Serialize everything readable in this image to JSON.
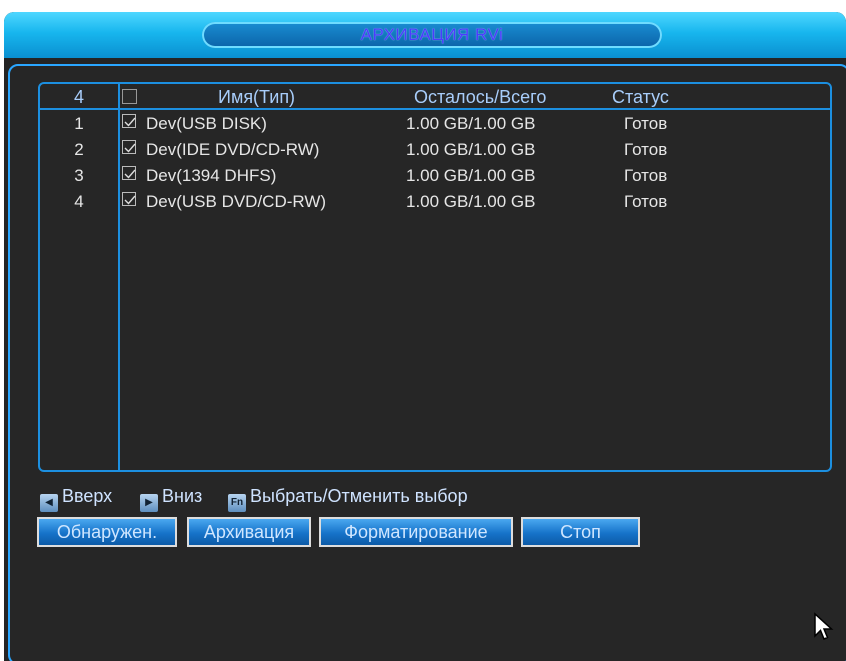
{
  "window": {
    "title": "АРХИВАЦИЯ RVi"
  },
  "table": {
    "header": {
      "count": "4",
      "name": "Имя(Тип)",
      "space": "Осталось/Всего",
      "status": "Статус"
    },
    "rows": [
      {
        "num": "1",
        "name": "Dev(USB DISK)",
        "space": "1.00 GB/1.00 GB",
        "status": "Готов",
        "checked": true
      },
      {
        "num": "2",
        "name": "Dev(IDE DVD/CD-RW)",
        "space": "1.00 GB/1.00 GB",
        "status": "Готов",
        "checked": true
      },
      {
        "num": "3",
        "name": "Dev(1394 DHFS)",
        "space": "1.00 GB/1.00 GB",
        "status": "Готов",
        "checked": true
      },
      {
        "num": "4",
        "name": "Dev(USB DVD/CD-RW)",
        "space": "1.00 GB/1.00 GB",
        "status": "Готов",
        "checked": true
      }
    ]
  },
  "hints": {
    "up": "Вверх",
    "down": "Вниз",
    "fn_key": "Fn",
    "select": "Выбрать/Отменить выбор"
  },
  "buttons": {
    "detect": "Обнаружен.",
    "backup": "Архивация",
    "format": "Форматирование",
    "stop": "Стоп"
  },
  "colors": {
    "accent": "#1c8fe0",
    "title_bar": "#17b6ee",
    "background": "#242424"
  }
}
